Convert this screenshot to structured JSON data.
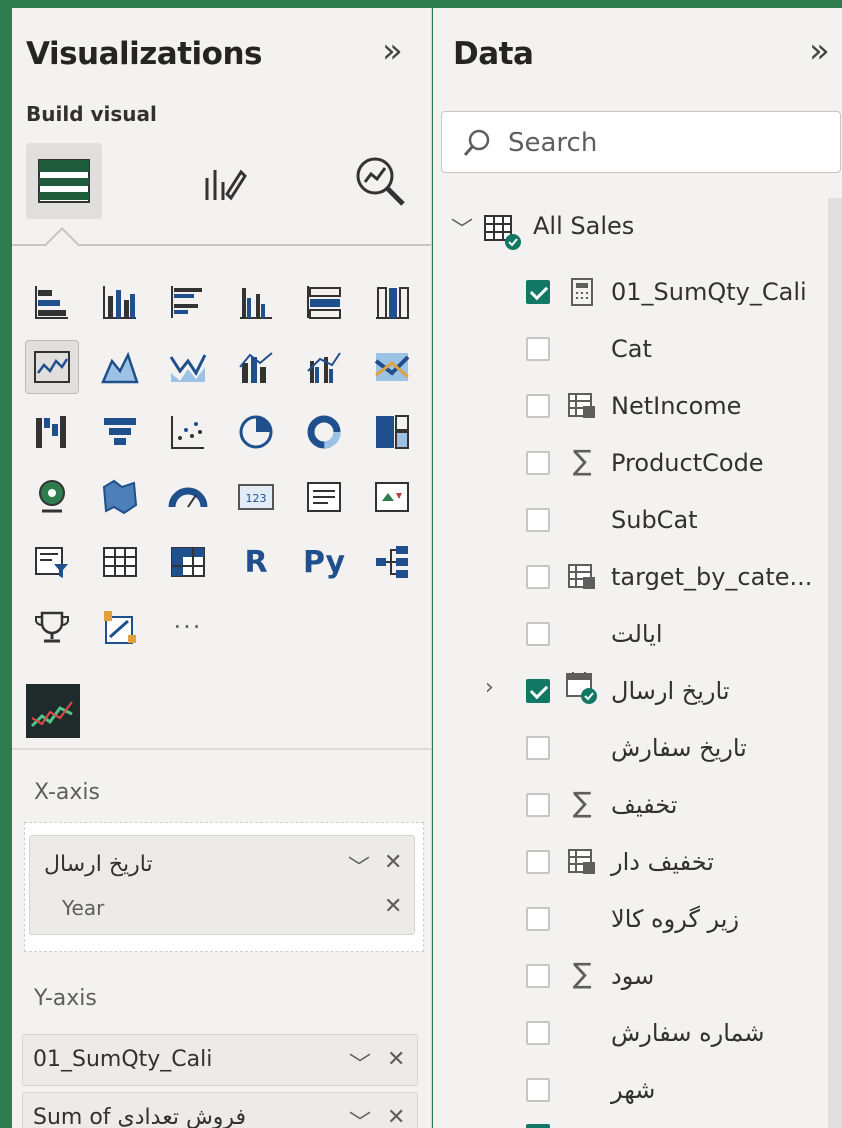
{
  "viz_pane": {
    "title": "Visualizations",
    "collapse_glyph": "»",
    "build_visual": "Build visual",
    "gallery": [
      "stacked-bar-chart-icon",
      "stacked-column-chart-icon",
      "clustered-bar-chart-icon",
      "clustered-column-chart-icon",
      "100-stacked-bar-chart-icon",
      "100-stacked-column-chart-icon",
      "line-chart-icon",
      "area-chart-icon",
      "stacked-area-chart-icon",
      "line-stacked-column-chart-icon",
      "line-clustered-column-chart-icon",
      "ribbon-chart-icon",
      "waterfall-chart-icon",
      "funnel-icon",
      "scatter-chart-icon",
      "pie-chart-icon",
      "donut-chart-icon",
      "treemap-icon",
      "map-icon",
      "filled-map-icon",
      "gauge-icon",
      "card-icon",
      "multi-row-card-icon",
      "kpi-icon",
      "slicer-icon",
      "table-icon",
      "matrix-icon",
      "r-visual-icon",
      "python-visual-icon",
      "decomposition-tree-icon",
      "key-influencers-icon",
      "smart-narrative-icon",
      "more-visuals-icon"
    ],
    "r_label": "R",
    "py_label": "Py",
    "more_label": "···",
    "x_axis": {
      "label": "X-axis",
      "field": "تاریخ ارسال",
      "sub": "Year"
    },
    "y_axis": {
      "label": "Y-axis",
      "fields": [
        "01_SumQty_Cali",
        "Sum of فروش تعدادی"
      ]
    }
  },
  "data_pane": {
    "title": "Data",
    "collapse_glyph": "»",
    "search_placeholder": "Search",
    "table_name": "All Sales",
    "fields": [
      {
        "name": "01_SumQty_Cali",
        "checked": true,
        "icon": "calculator-icon"
      },
      {
        "name": "Cat",
        "checked": false,
        "icon": ""
      },
      {
        "name": "NetIncome",
        "checked": false,
        "icon": "calculated-column-icon"
      },
      {
        "name": "ProductCode",
        "checked": false,
        "icon": "sigma-icon"
      },
      {
        "name": "SubCat",
        "checked": false,
        "icon": ""
      },
      {
        "name": "target_by_cate...",
        "checked": false,
        "icon": "calculated-column-icon"
      },
      {
        "name": "ایالت",
        "checked": false,
        "icon": ""
      },
      {
        "name": "تاریخ ارسال",
        "checked": true,
        "icon": "calendar-icon",
        "expandable": true
      },
      {
        "name": "تاریخ سفارش",
        "checked": false,
        "icon": ""
      },
      {
        "name": "تخفیف",
        "checked": false,
        "icon": "sigma-icon"
      },
      {
        "name": "تخفیف دار",
        "checked": false,
        "icon": "calculated-column-icon"
      },
      {
        "name": "زیر گروه کالا",
        "checked": false,
        "icon": ""
      },
      {
        "name": "سود",
        "checked": false,
        "icon": "sigma-icon"
      },
      {
        "name": "شماره سفارش",
        "checked": false,
        "icon": ""
      },
      {
        "name": "شهر",
        "checked": false,
        "icon": ""
      }
    ]
  }
}
